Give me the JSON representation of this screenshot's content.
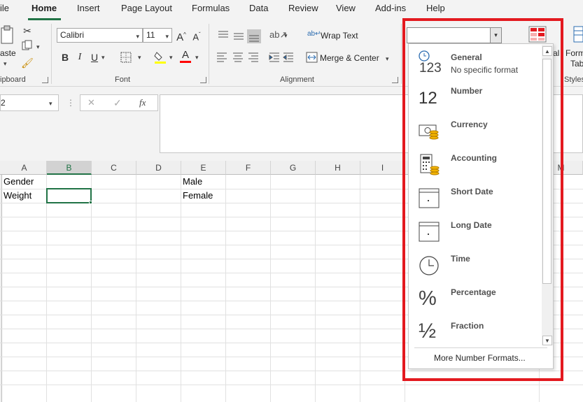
{
  "menu": {
    "tabs": [
      "ile",
      "Home",
      "Insert",
      "Page Layout",
      "Formulas",
      "Data",
      "Review",
      "View",
      "Add-ins",
      "Help"
    ],
    "active": "Home"
  },
  "ribbon": {
    "clipboard": {
      "paste_label": "aste",
      "group_label": "ipboard"
    },
    "font": {
      "name": "Calibri",
      "size": "11",
      "group_label": "Font",
      "grow_label": "A",
      "shrink_label": "A",
      "bold": "B",
      "italic": "I",
      "underline": "U",
      "font_color_glyph": "A"
    },
    "alignment": {
      "wrap_text": "Wrap Text",
      "merge_center": "Merge & Center",
      "group_label": "Alignment"
    },
    "number": {
      "format_value": ""
    },
    "styles": {
      "conditional_partial": "al",
      "format_table_line1": "Form",
      "format_table_line2": "Tab",
      "group_label": "Styles"
    }
  },
  "formula_bar": {
    "name_box": "2",
    "fx_label": "fx",
    "cancel": "✕",
    "enter": "✓",
    "formula": ""
  },
  "grid": {
    "columns": [
      "A",
      "B",
      "C",
      "D",
      "E",
      "F",
      "G",
      "H",
      "I",
      "M"
    ],
    "selected_column": "B",
    "cells": {
      "A1": "Gender",
      "A2": "Weight",
      "E1": "Male",
      "E2": "Female"
    }
  },
  "number_format_dropdown": {
    "items": [
      {
        "title": "General",
        "subtitle": "No specific format",
        "icon": "general-123-icon",
        "glyph": "123"
      },
      {
        "title": "Number",
        "subtitle": "",
        "icon": "number-12-icon",
        "glyph": "12"
      },
      {
        "title": "Currency",
        "subtitle": "",
        "icon": "currency-icon",
        "glyph": ""
      },
      {
        "title": "Accounting",
        "subtitle": "",
        "icon": "accounting-icon",
        "glyph": ""
      },
      {
        "title": "Short Date",
        "subtitle": "",
        "icon": "short-date-icon",
        "glyph": ""
      },
      {
        "title": "Long Date",
        "subtitle": "",
        "icon": "long-date-icon",
        "glyph": ""
      },
      {
        "title": "Time",
        "subtitle": "",
        "icon": "time-clock-icon",
        "glyph": ""
      },
      {
        "title": "Percentage",
        "subtitle": "",
        "icon": "percentage-icon",
        "glyph": "%"
      },
      {
        "title": "Fraction",
        "subtitle": "",
        "icon": "fraction-icon",
        "glyph": "½"
      }
    ],
    "more_label": "More Number Formats...",
    "highlight_color": "#e3191f"
  },
  "colors": {
    "accent": "#217346",
    "highlight": "#e3191f",
    "fill_yellow": "#ffff00",
    "font_red": "#ff0000"
  }
}
